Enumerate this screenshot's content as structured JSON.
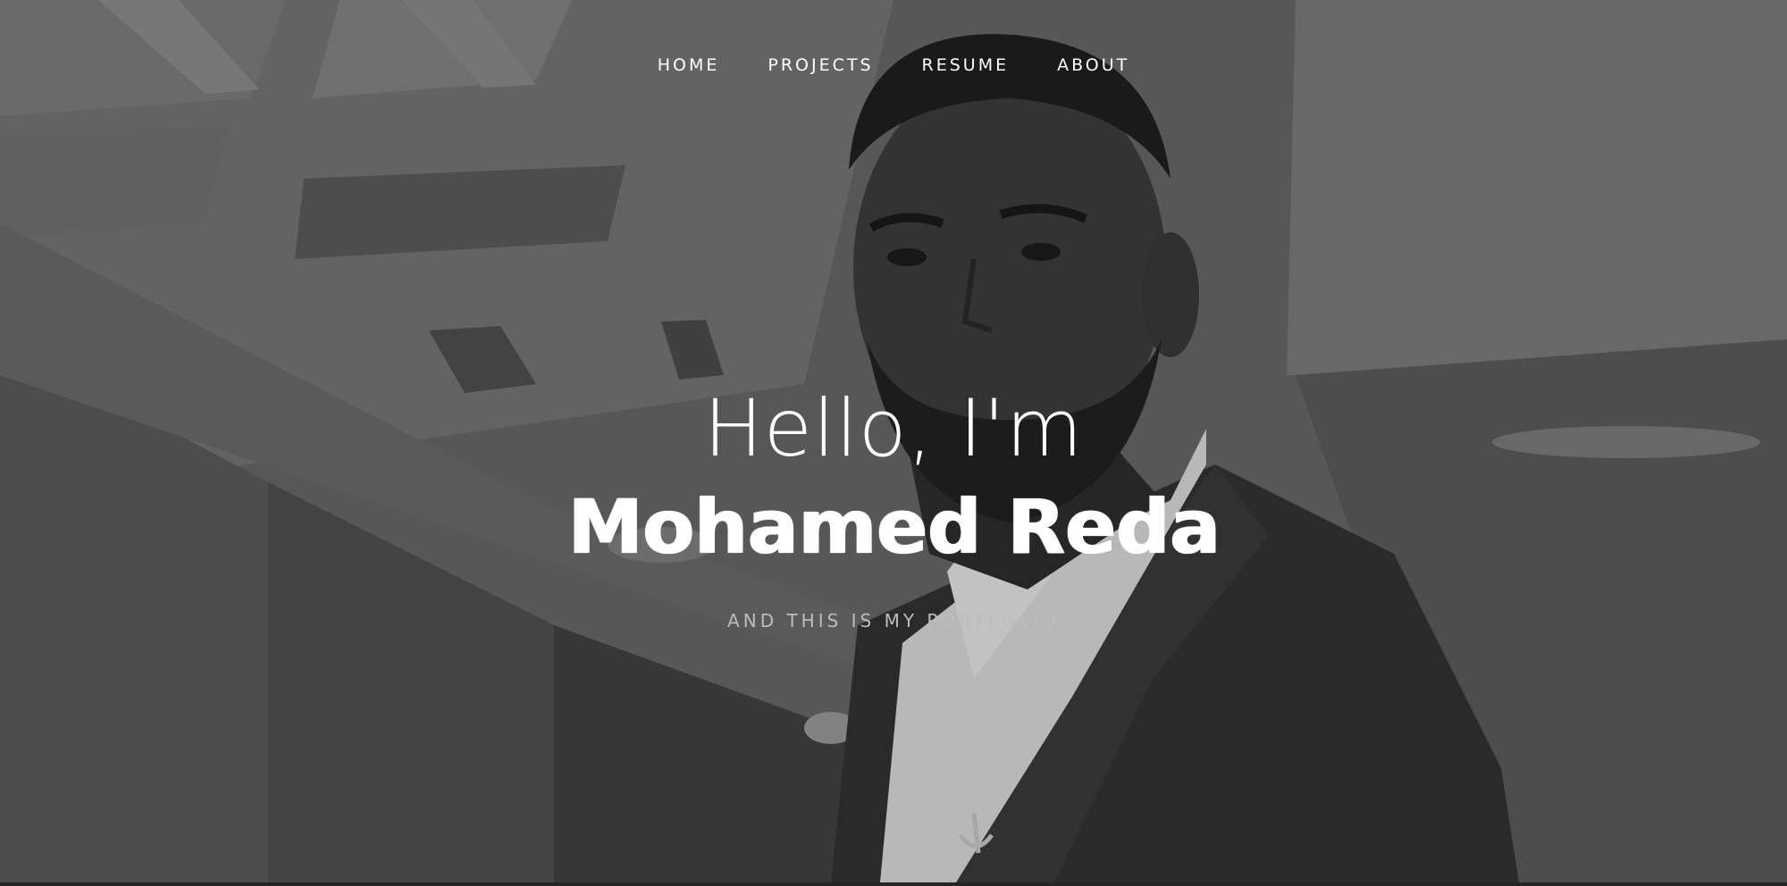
{
  "nav": {
    "items": [
      {
        "label": "HOME"
      },
      {
        "label": "PROJECTS"
      },
      {
        "label": "RESUME"
      },
      {
        "label": "ABOUT"
      }
    ]
  },
  "hero": {
    "greeting": "Hello, I'm",
    "name": "Mohamed Reda",
    "tagline": "AND THIS IS MY PORTFOLIO"
  },
  "colors": {
    "text": "#ffffff",
    "tagline": "#bdbdbd",
    "background": "#5c5c5c"
  }
}
